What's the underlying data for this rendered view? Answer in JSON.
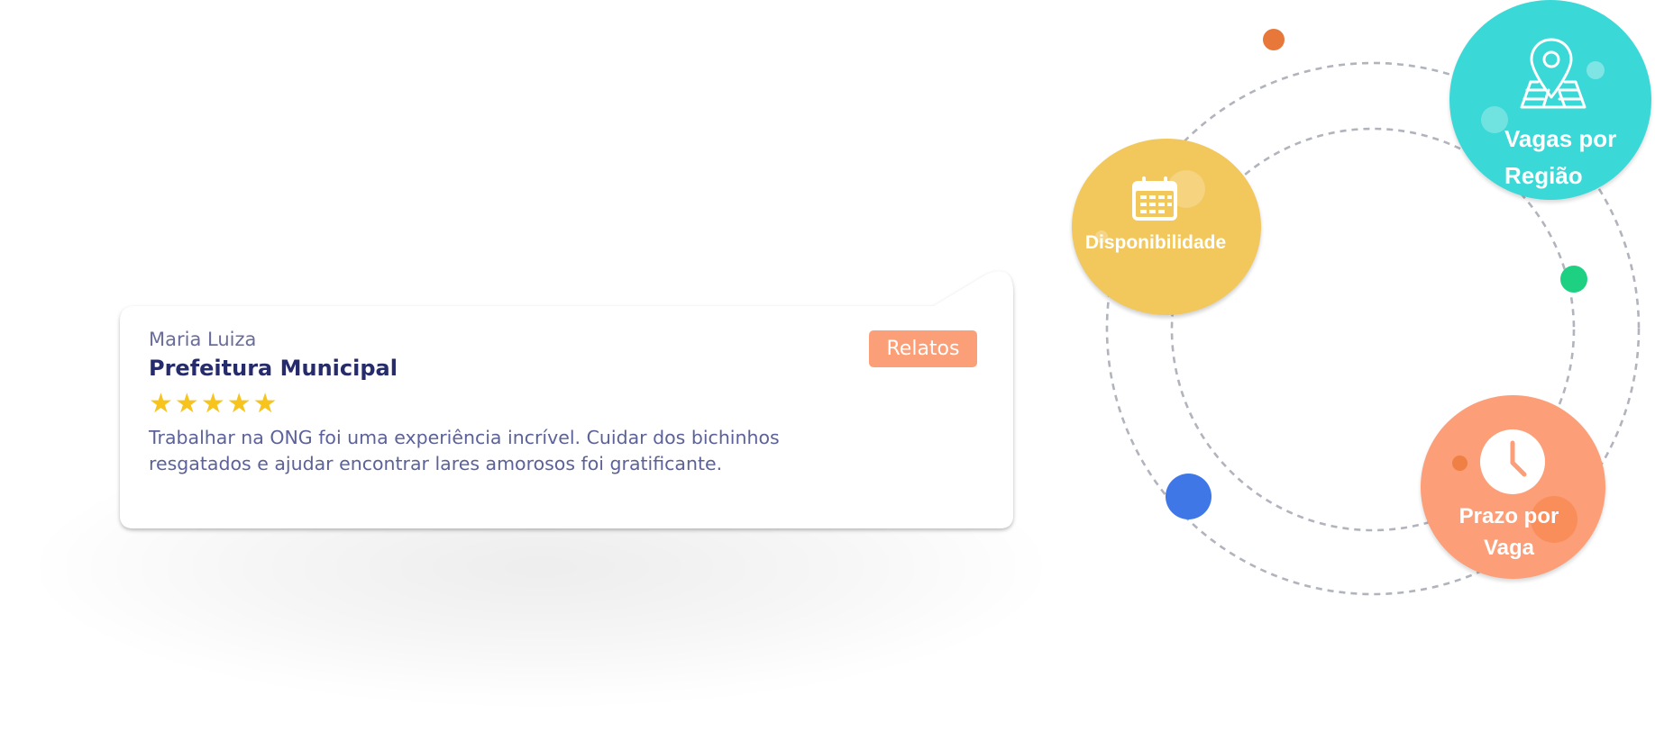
{
  "testimonial": {
    "author": "Maria Luiza",
    "company": "Prefeitura Municipal",
    "rating": 5,
    "rating_max": 5,
    "text": "Trabalhar na ONG foi uma experiência incrível. Cuidar dos bichinhos resgatados e ajudar encontrar lares amorosos foi gratificante.",
    "badge": "Relatos"
  },
  "features": {
    "availability": {
      "label": "Disponibilidade",
      "icon": "calendar-icon",
      "color": "#f2c75c"
    },
    "region": {
      "label_line1": "Vagas por",
      "label_line2": "Região",
      "icon": "map-pin-icon",
      "color": "#3ad8d6"
    },
    "deadline": {
      "label_line1": "Prazo por",
      "label_line2": "Vaga",
      "icon": "clock-icon",
      "color": "#fc9e78"
    }
  },
  "decor_colors": {
    "orange_dot": "#e8773a",
    "green_dot": "#1ed082",
    "blue_dot": "#3f77e6",
    "orbit_stroke": "#b1b3bd"
  }
}
